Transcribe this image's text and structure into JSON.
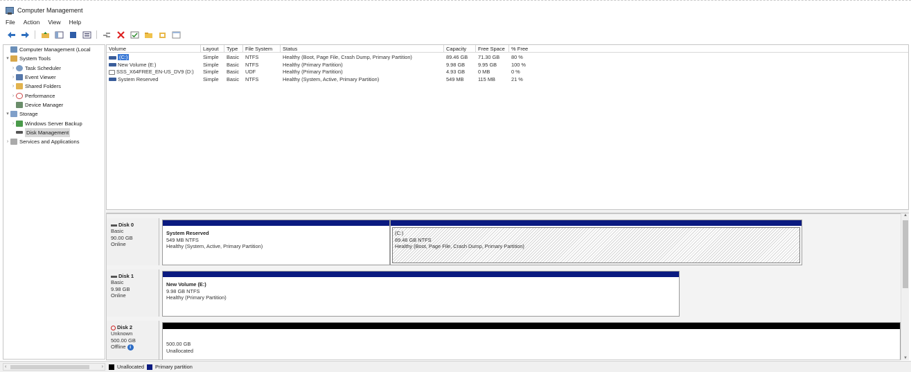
{
  "window": {
    "title": "Computer Management"
  },
  "menu": [
    "File",
    "Action",
    "View",
    "Help"
  ],
  "toolbar": [
    "back-icon",
    "forward-icon",
    "up-folder-icon",
    "show-hide-tree-icon",
    "properties-icon",
    "help-icon",
    "connect-icon",
    "delete-icon",
    "check-icon",
    "folder-icon",
    "wizard-icon",
    "view-icon"
  ],
  "tree": [
    {
      "label": "Computer Management (Local",
      "arrow": "",
      "icon": "computer-management-icon",
      "color": "#6b8fb8",
      "indent": 0
    },
    {
      "label": "System Tools",
      "arrow": "▾",
      "icon": "system-tools-icon",
      "color": "#d9a84a",
      "indent": 1
    },
    {
      "label": "Task Scheduler",
      "arrow": "›",
      "icon": "task-scheduler-icon",
      "color": "#7a9bc4",
      "indent": 2
    },
    {
      "label": "Event Viewer",
      "arrow": "›",
      "icon": "event-viewer-icon",
      "color": "#5577aa",
      "indent": 2
    },
    {
      "label": "Shared Folders",
      "arrow": "›",
      "icon": "shared-folders-icon",
      "color": "#e2b34e",
      "indent": 2
    },
    {
      "label": "Performance",
      "arrow": "›",
      "icon": "performance-icon",
      "color": "#c44",
      "indent": 2
    },
    {
      "label": "Device Manager",
      "arrow": "",
      "icon": "device-manager-icon",
      "color": "#6a8d6a",
      "indent": 2
    },
    {
      "label": "Storage",
      "arrow": "▾",
      "icon": "storage-icon",
      "color": "#7f9fc9",
      "indent": 1
    },
    {
      "label": "Windows Server Backup",
      "arrow": "›",
      "icon": "windows-server-backup-icon",
      "color": "#4a9a4a",
      "indent": 2
    },
    {
      "label": "Disk Management",
      "arrow": "",
      "icon": "disk-management-icon",
      "color": "#555",
      "indent": 2,
      "selected": true
    },
    {
      "label": "Services and Applications",
      "arrow": "›",
      "icon": "services-and-applications-icon",
      "color": "#999",
      "indent": 1
    }
  ],
  "volume_table": {
    "headers": [
      "Volume",
      "Layout",
      "Type",
      "File System",
      "Status",
      "Capacity",
      "Free Space",
      "% Free"
    ],
    "rows": [
      [
        "(C:)",
        "Simple",
        "Basic",
        "NTFS",
        "Healthy (Boot, Page File, Crash Dump, Primary Partition)",
        "89.46 GB",
        "71.30 GB",
        "80 %"
      ],
      [
        "New Volume (E:)",
        "Simple",
        "Basic",
        "NTFS",
        "Healthy (Primary Partition)",
        "9.98 GB",
        "9.95 GB",
        "100 %"
      ],
      [
        "SSS_X64FREE_EN-US_DV9 (D:)",
        "Simple",
        "Basic",
        "UDF",
        "Healthy (Primary Partition)",
        "4.93 GB",
        "0 MB",
        "0 %"
      ],
      [
        "System Reserved",
        "Simple",
        "Basic",
        "NTFS",
        "Healthy (System, Active, Primary Partition)",
        "549 MB",
        "115 MB",
        "21 %"
      ]
    ],
    "row_icons": [
      "volume-icon",
      "volume-icon",
      "dvd-icon",
      "volume-icon"
    ]
  },
  "disks": [
    {
      "name": "Disk 0",
      "type": "Basic",
      "size": "90.00 GB",
      "status": "Online",
      "partitions": [
        {
          "name": "System Reserved",
          "detail": "549 MB NTFS",
          "status": "Healthy (System, Active, Primary Partition)",
          "bar_color": "#0a1a80"
        },
        {
          "name": "(C:)",
          "detail": "89.46 GB NTFS",
          "status": "Healthy (Boot, Page File, Crash Dump, Primary Partition)",
          "bar_color": "#0a1a80"
        }
      ]
    },
    {
      "name": "Disk 1",
      "type": "Basic",
      "size": "9.98 GB",
      "status": "Online",
      "partitions": [
        {
          "name": "New Volume (E:)",
          "detail": "9.98 GB NTFS",
          "status": "Healthy (Primary Partition)",
          "bar_color": "#0a1a80"
        }
      ]
    },
    {
      "name": "Disk 2",
      "type": "Unknown",
      "size": "500.00 GB",
      "status": "Offline",
      "partitions": [
        {
          "detail": "500.00 GB",
          "status": "Unallocated",
          "bar_color": "#000000"
        }
      ]
    }
  ],
  "legend": [
    {
      "label": "Unallocated",
      "color": "#000000"
    },
    {
      "label": "Primary partition",
      "color": "#0a1a80"
    }
  ]
}
